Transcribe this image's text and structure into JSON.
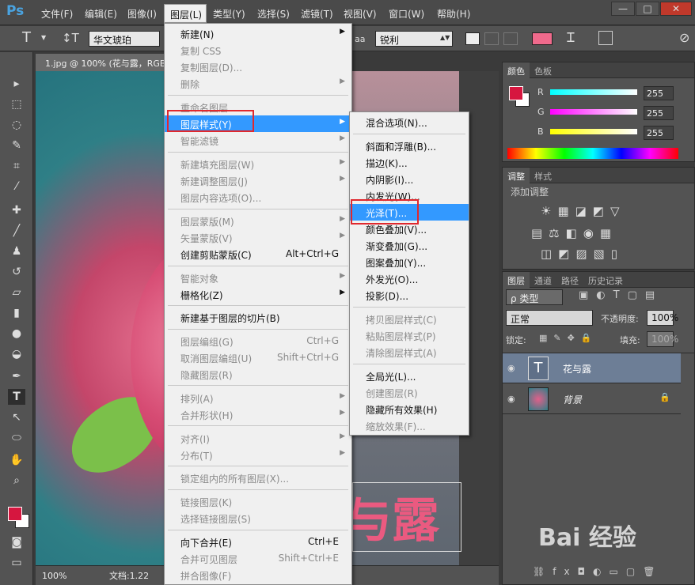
{
  "app": {
    "logo": "Ps"
  },
  "menubar": {
    "items": [
      "文件(F)",
      "编辑(E)",
      "图像(I)",
      "图层(L)",
      "类型(Y)",
      "选择(S)",
      "滤镜(T)",
      "视图(V)",
      "窗口(W)",
      "帮助(H)"
    ],
    "win": [
      "—",
      "□",
      "✕"
    ]
  },
  "options": {
    "font": "华文琥珀",
    "aa_label": "aa",
    "aa": "锐利",
    "color": "#f06a8c"
  },
  "document": {
    "tab": "1.jpg @ 100% (花与露，RGB",
    "zoom": "100%",
    "status": "文档:1.22",
    "text": "与露"
  },
  "layer_menu": {
    "items": [
      {
        "label": "新建(N)",
        "sub": true
      },
      {
        "label": "复制 CSS",
        "dis": true
      },
      {
        "label": "复制图层(D)...",
        "dis": true
      },
      {
        "label": "删除",
        "dis": true,
        "sub": true
      },
      {
        "label": "重命名图层...",
        "dis": true
      },
      {
        "label": "图层样式(Y)",
        "sub": true,
        "hl": true
      },
      {
        "label": "智能滤镜",
        "dis": true,
        "sub": true
      },
      {
        "label": "新建填充图层(W)",
        "dis": true,
        "sub": true
      },
      {
        "label": "新建调整图层(J)",
        "dis": true,
        "sub": true
      },
      {
        "label": "图层内容选项(O)...",
        "dis": true
      },
      {
        "label": "图层蒙版(M)",
        "dis": true,
        "sub": true
      },
      {
        "label": "矢量蒙版(V)",
        "dis": true,
        "sub": true
      },
      {
        "label": "创建剪贴蒙版(C)",
        "sc": "Alt+Ctrl+G"
      },
      {
        "label": "智能对象",
        "dis": true,
        "sub": true
      },
      {
        "label": "栅格化(Z)",
        "sub": true
      },
      {
        "label": "新建基于图层的切片(B)"
      },
      {
        "label": "图层编组(G)",
        "dis": true,
        "sc": "Ctrl+G"
      },
      {
        "label": "取消图层编组(U)",
        "dis": true,
        "sc": "Shift+Ctrl+G"
      },
      {
        "label": "隐藏图层(R)",
        "dis": true
      },
      {
        "label": "排列(A)",
        "dis": true,
        "sub": true
      },
      {
        "label": "合并形状(H)",
        "dis": true,
        "sub": true
      },
      {
        "label": "对齐(I)",
        "dis": true,
        "sub": true
      },
      {
        "label": "分布(T)",
        "dis": true,
        "sub": true
      },
      {
        "label": "锁定组内的所有图层(X)...",
        "dis": true
      },
      {
        "label": "链接图层(K)",
        "dis": true
      },
      {
        "label": "选择链接图层(S)",
        "dis": true
      },
      {
        "label": "向下合并(E)",
        "sc": "Ctrl+E"
      },
      {
        "label": "合并可见图层",
        "dis": true,
        "sc": "Shift+Ctrl+E"
      },
      {
        "label": "拼合图像(F)",
        "dis": true
      }
    ]
  },
  "style_menu": {
    "items": [
      {
        "label": "混合选项(N)..."
      },
      {
        "label": "斜面和浮雕(B)..."
      },
      {
        "label": "描边(K)..."
      },
      {
        "label": "内阴影(I)..."
      },
      {
        "label": "内发光(W)..."
      },
      {
        "label": "光泽(T)...",
        "hl": true
      },
      {
        "label": "颜色叠加(V)..."
      },
      {
        "label": "渐变叠加(G)..."
      },
      {
        "label": "图案叠加(Y)..."
      },
      {
        "label": "外发光(O)..."
      },
      {
        "label": "投影(D)..."
      },
      {
        "label": "拷贝图层样式(C)",
        "dis": true
      },
      {
        "label": "粘贴图层样式(P)",
        "dis": true
      },
      {
        "label": "清除图层样式(A)",
        "dis": true
      },
      {
        "label": "全局光(L)..."
      },
      {
        "label": "创建图层(R)",
        "dis": true
      },
      {
        "label": "隐藏所有效果(H)"
      },
      {
        "label": "缩放效果(F)...",
        "dis": true
      }
    ]
  },
  "color_panel": {
    "tabs": [
      "颜色",
      "色板"
    ],
    "r_label": "R",
    "g_label": "G",
    "b_label": "B",
    "r": "255",
    "g": "255",
    "b": "255",
    "fg": "#d6163f"
  },
  "adjust_panel": {
    "tabs": [
      "调整",
      "样式"
    ],
    "title": "添加调整"
  },
  "layers_panel": {
    "tabs": [
      "图层",
      "通道",
      "路径",
      "历史记录"
    ],
    "filter": "ρ 类型",
    "blend": "正常",
    "opacity_label": "不透明度:",
    "opacity": "100%",
    "lock_label": "锁定:",
    "fill_label": "填充:",
    "fill": "100%",
    "layers": [
      {
        "name": "花与露",
        "type": "T"
      },
      {
        "name": "背景"
      }
    ]
  },
  "watermark": "Bai 经验"
}
